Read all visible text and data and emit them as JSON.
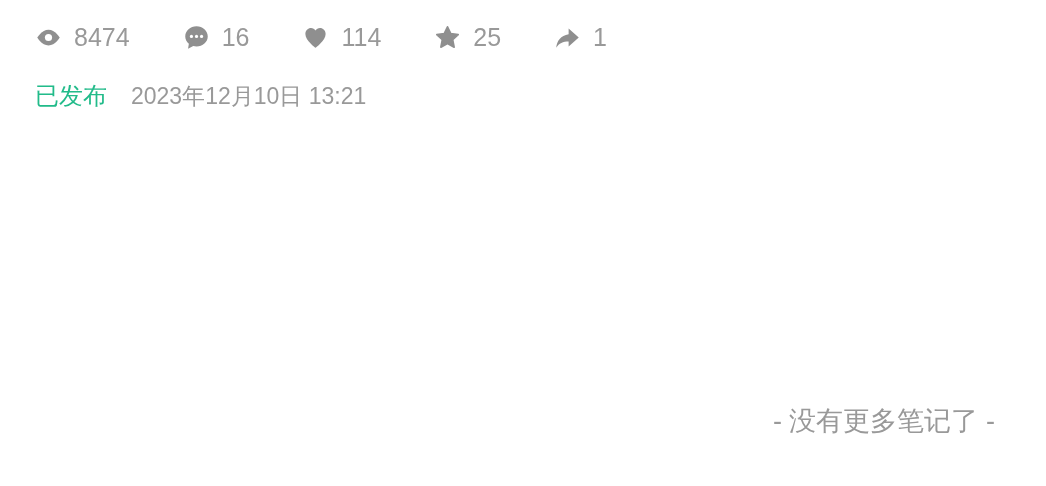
{
  "stats": [
    {
      "kind": "views",
      "count": "8474"
    },
    {
      "kind": "comments",
      "count": "16"
    },
    {
      "kind": "likes",
      "count": "114"
    },
    {
      "kind": "favorites",
      "count": "25"
    },
    {
      "kind": "shares",
      "count": "1"
    }
  ],
  "status": {
    "label": "已发布",
    "date": "2023年12月10日 13:21"
  },
  "footer": "- 没有更多笔记了 -"
}
